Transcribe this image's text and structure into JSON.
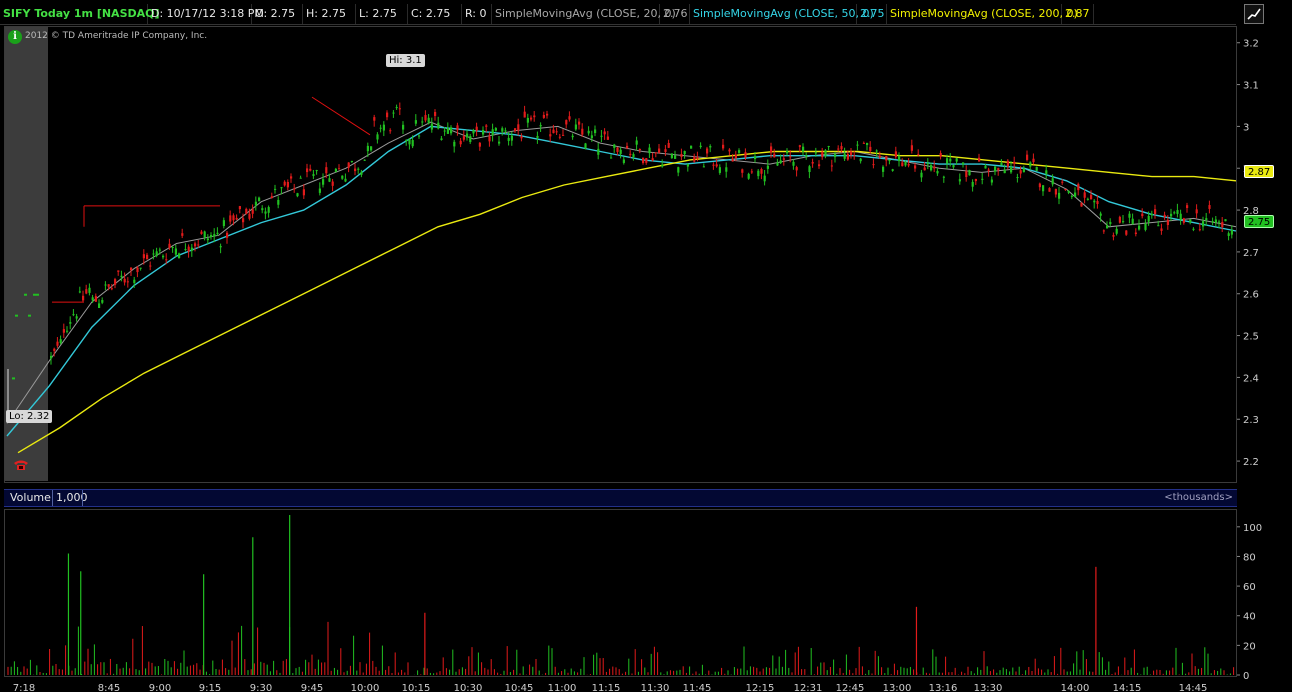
{
  "header": {
    "symbol": "SIFY Today 1m [NASDAQ]",
    "date": "D: 10/17/12 3:18 PM",
    "open": "O: 2.75",
    "high": "H: 2.75",
    "low": "L: 2.75",
    "close": "C: 2.75",
    "range": "R: 0",
    "sma20_label": "SimpleMovingAvg (CLOSE, 20, 0)",
    "sma20_value": "2.76",
    "sma50_label": "SimpleMovingAvg (CLOSE, 50, 0)",
    "sma50_value": "2.75",
    "sma200_label": "SimpleMovingAvg (CLOSE, 200, 0)",
    "sma200_value": "2.87",
    "menu_icon": "chart-style-icon"
  },
  "copyright": "2012 © TD Ameritrade IP Company, Inc.",
  "info_icon": "info-icon",
  "phone_icon": "phone-icon",
  "hi_label": "Hi: 3.1",
  "lo_label": "Lo: 2.32",
  "price_tags": {
    "sma200": "2.87",
    "last": "2.75"
  },
  "volume_header": {
    "title": "Volume",
    "value": "1,000",
    "units": "<thousands>"
  },
  "colors": {
    "up": "#21c021",
    "down": "#e21b1b",
    "sma20": "#9a9a9a",
    "sma50": "#33c8d8",
    "sma200": "#eaea10"
  },
  "chart_data": [
    {
      "type": "candlestick",
      "title": "SIFY Today 1m [NASDAQ]",
      "xlabel": "",
      "ylabel": "",
      "ylim": [
        2.15,
        3.24
      ],
      "y_ticks": [
        "3.2",
        "3.1",
        "3",
        "2.9",
        "2.8",
        "2.7",
        "2.6",
        "2.5",
        "2.4",
        "2.3",
        "2.2"
      ],
      "x_ticks": [
        "7:18",
        "8:45",
        "9:00",
        "9:15",
        "9:30",
        "9:45",
        "10:00",
        "10:15",
        "10:30",
        "10:45",
        "11:00",
        "11:15",
        "11:30",
        "11:45",
        "12:15",
        "12:31",
        "12:45",
        "13:00",
        "13:16",
        "13:30",
        "14:00",
        "14:15",
        "14:45"
      ],
      "grid": false,
      "series": [
        {
          "name": "SimpleMovingAvg (CLOSE, 20, 0)",
          "line": [
            2.29,
            2.44,
            2.58,
            2.66,
            2.72,
            2.74,
            2.82,
            2.86,
            2.9,
            2.96,
            3.01,
            2.97,
            2.99,
            3.0,
            2.96,
            2.94,
            2.93,
            2.92,
            2.91,
            2.93,
            2.94,
            2.92,
            2.9,
            2.89,
            2.9,
            2.85,
            2.76,
            2.77,
            2.78,
            2.76
          ]
        },
        {
          "name": "SimpleMovingAvg (CLOSE, 50, 0)",
          "line": [
            2.26,
            2.38,
            2.52,
            2.62,
            2.69,
            2.73,
            2.77,
            2.8,
            2.86,
            2.94,
            3.0,
            2.99,
            2.98,
            2.96,
            2.94,
            2.92,
            2.91,
            2.92,
            2.93,
            2.93,
            2.93,
            2.92,
            2.91,
            2.91,
            2.9,
            2.87,
            2.82,
            2.79,
            2.77,
            2.75
          ]
        },
        {
          "name": "SimpleMovingAvg (CLOSE, 200, 0)",
          "line": [
            2.22,
            2.28,
            2.35,
            2.41,
            2.46,
            2.51,
            2.56,
            2.61,
            2.66,
            2.71,
            2.76,
            2.79,
            2.83,
            2.86,
            2.88,
            2.9,
            2.92,
            2.93,
            2.94,
            2.94,
            2.94,
            2.93,
            2.93,
            2.92,
            2.91,
            2.9,
            2.89,
            2.88,
            2.88,
            2.87
          ]
        }
      ],
      "high": 3.1,
      "low": 2.32,
      "last": 2.75
    },
    {
      "type": "bar",
      "title": "Volume",
      "units": "<thousands>",
      "ylim": [
        0,
        110
      ],
      "y_ticks": [
        "100",
        "80",
        "60",
        "40",
        "20",
        "0"
      ],
      "spikes": [
        {
          "t": 0.05,
          "value": 82,
          "dir": "up"
        },
        {
          "t": 0.06,
          "value": 70,
          "dir": "up"
        },
        {
          "t": 0.16,
          "value": 68,
          "dir": "up"
        },
        {
          "t": 0.2,
          "value": 93,
          "dir": "up"
        },
        {
          "t": 0.23,
          "value": 108,
          "dir": "up"
        },
        {
          "t": 0.34,
          "value": 42,
          "dir": "down"
        },
        {
          "t": 0.74,
          "value": 46,
          "dir": "down"
        },
        {
          "t": 0.886,
          "value": 73,
          "dir": "down"
        }
      ]
    }
  ]
}
